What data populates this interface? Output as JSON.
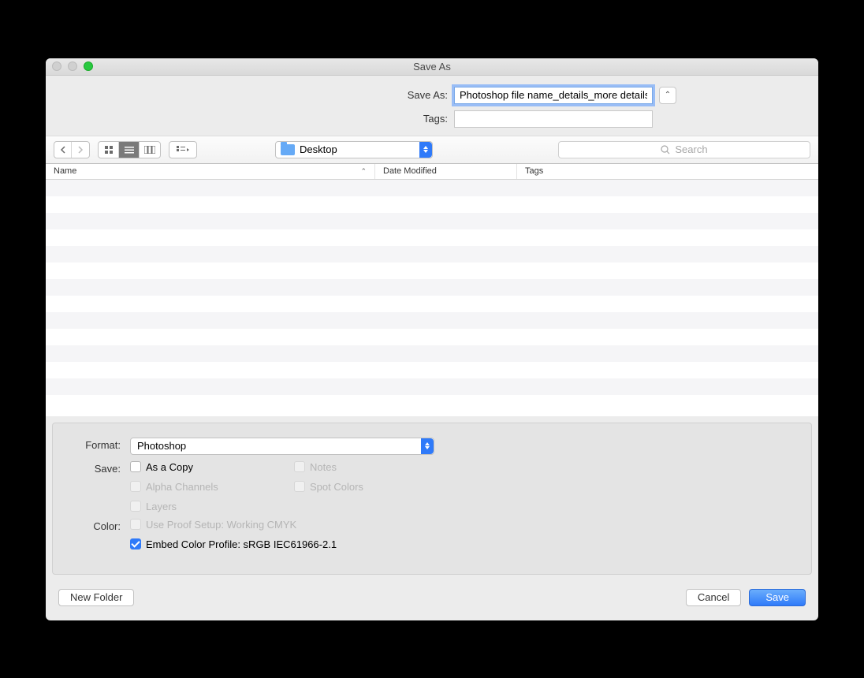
{
  "window": {
    "title": "Save As"
  },
  "form": {
    "save_as_label": "Save As:",
    "filename_value": "Photoshop file name_details_more details",
    "tags_label": "Tags:",
    "tags_value": ""
  },
  "toolbar": {
    "location_label": "Desktop",
    "search_placeholder": "Search"
  },
  "columns": {
    "name": "Name",
    "date": "Date Modified",
    "tags": "Tags"
  },
  "options": {
    "format_label": "Format:",
    "format_value": "Photoshop",
    "save_label": "Save:",
    "as_a_copy": "As a Copy",
    "notes": "Notes",
    "alpha_channels": "Alpha Channels",
    "spot_colors": "Spot Colors",
    "layers": "Layers",
    "color_label": "Color:",
    "use_proof_setup": "Use Proof Setup:  Working CMYK",
    "embed_color_profile": "Embed Color Profile:  sRGB IEC61966-2.1"
  },
  "footer": {
    "new_folder": "New Folder",
    "cancel": "Cancel",
    "save": "Save"
  }
}
